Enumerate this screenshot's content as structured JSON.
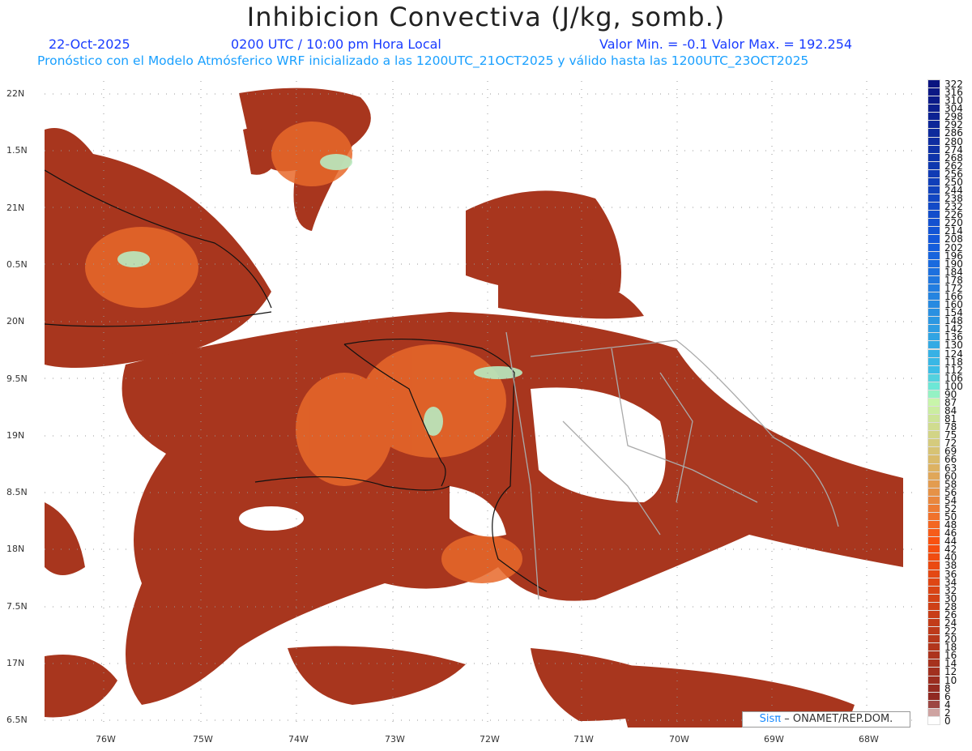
{
  "header": {
    "title": "Inhibicion Convectiva (J/kg, somb.)",
    "date": "22-Oct-2025",
    "time": "0200 UTC / 10:00 pm Hora Local",
    "minmax": "Valor Min. = -0.1  Valor Max. = 192.254",
    "model": "Pronóstico con el Modelo Atmósferico WRF inicializado a las 1200UTC_21OCT2025 y válido hasta las  1200UTC_23OCT2025"
  },
  "axes": {
    "lon": [
      "76W",
      "75W",
      "74W",
      "73W",
      "72W",
      "71W",
      "70W",
      "69W",
      "68W"
    ],
    "lat": [
      "22N",
      "1.5N",
      "21N",
      "0.5N",
      "20N",
      "9.5N",
      "19N",
      "8.5N",
      "18N",
      "7.5N",
      "17N",
      "6.5N"
    ]
  },
  "colorbar": {
    "labels": [
      "322",
      "316",
      "310",
      "304",
      "298",
      "292",
      "286",
      "280",
      "274",
      "268",
      "262",
      "256",
      "250",
      "244",
      "238",
      "232",
      "226",
      "220",
      "214",
      "208",
      "202",
      "196",
      "190",
      "184",
      "178",
      "172",
      "166",
      "160",
      "154",
      "148",
      "142",
      "136",
      "130",
      "124",
      "118",
      "112",
      "106",
      "100",
      "90",
      "87",
      "84",
      "81",
      "78",
      "75",
      "72",
      "69",
      "66",
      "63",
      "60",
      "58",
      "56",
      "54",
      "52",
      "50",
      "48",
      "46",
      "44",
      "42",
      "40",
      "38",
      "36",
      "34",
      "32",
      "30",
      "28",
      "26",
      "24",
      "22",
      "20",
      "18",
      "16",
      "14",
      "12",
      "10",
      "8",
      "6",
      "4",
      "2",
      "0"
    ]
  },
  "credit": {
    "brand": "Sisπ",
    "text": "– ONAMET/REP.DOM."
  },
  "colors": {
    "low": "#8b2a22",
    "mid": "#f05a10",
    "high": "#b9f0c0",
    "blue": "#0a1a80"
  }
}
